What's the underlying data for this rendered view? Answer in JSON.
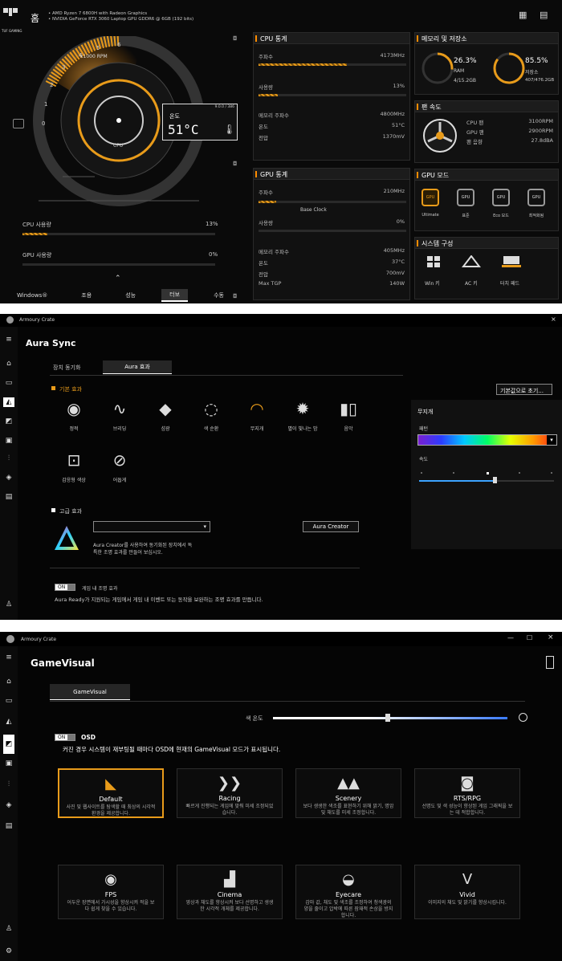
{
  "p1": {
    "logo_text": "TUF GAMING",
    "home": "홈",
    "cpu_name": "AMD Ryzen 7 6800H with Radeon Graphics",
    "gpu_name": "NVIDIA GeForce RTX 3060 Laptop GPU GDDR6 @ 6GB (192 bits)",
    "gauge_unit": "x1000 RPM",
    "gauge_ticks": [
      "1",
      "2",
      "3",
      "4",
      "5",
      "6",
      "0"
    ],
    "gauge_center": "CPU",
    "temp_code": "9.0.0 / 386",
    "temp_label": "온도",
    "temp_value": "51°C",
    "cpu_usage_label": "CPU 사용량",
    "cpu_usage_value": "13%",
    "cpu_usage_fraction": 0.13,
    "gpu_usage_label": "GPU 사용량",
    "gpu_usage_value": "0%",
    "gpu_usage_fraction": 0.0,
    "modes": [
      "Windows®",
      "조용",
      "성능",
      "터보",
      "수동"
    ],
    "active_mode": "터보",
    "cpu_stats": {
      "title": "CPU 통계",
      "freq_label": "주파수",
      "freq_value": "4173MHz",
      "usage_label": "사용량",
      "usage_value": "13%",
      "mem_freq_label": "메모리 주파수",
      "mem_freq_value": "4800MHz",
      "temp_label": "온도",
      "temp_value": "51°C",
      "volt_label": "전압",
      "volt_value": "1370mV"
    },
    "gpu_stats": {
      "title": "GPU 통계",
      "freq_label": "주파수",
      "freq_value": "210MHz",
      "base_clock": "Base Clock",
      "usage_label": "사용량",
      "usage_value": "0%",
      "mem_freq_label": "메모리 주파수",
      "mem_freq_value": "405MHz",
      "temp_label": "온도",
      "temp_value": "37°C",
      "volt_label": "전압",
      "volt_value": "700mV",
      "tgp_label": "Max TGP",
      "tgp_value": "140W"
    },
    "memory": {
      "title": "메모리 및 저장소",
      "ram_pct": "26.3%",
      "ram_label": "RAM",
      "ram_detail": "4/15.2GB",
      "ram_fraction": 0.263,
      "disk_pct": "85.5%",
      "disk_label": "저장소",
      "disk_detail": "407/476.2GB",
      "disk_fraction": 0.855
    },
    "fan": {
      "title": "팬 속도",
      "cpu_label": "CPU 팬",
      "cpu_value": "3100RPM",
      "gpu_label": "GPU 팬",
      "gpu_value": "2900RPM",
      "noise_label": "팬 음향",
      "noise_value": "27.8dBA"
    },
    "gpu_mode": {
      "title": "GPU 모드",
      "items": [
        "Ultimate",
        "표준",
        "Eco 모드",
        "최적화됨"
      ],
      "icon_text": "GPU"
    },
    "system": {
      "title": "시스템 구성",
      "items": [
        "Win 키",
        "AC 키",
        "터치 패드"
      ]
    }
  },
  "p2": {
    "app_title": "Armoury Crate",
    "page_title": "Aura Sync",
    "tabs": [
      "장치 동기화",
      "Aura 효과"
    ],
    "section_basic": "기본 효과",
    "reset_button": "기본값으로 초기...",
    "effects": [
      "정적",
      "브리딩",
      "섬광",
      "색 순환",
      "무지개",
      "별이 빛나는 밤",
      "음악",
      "감응형 색상",
      "어둡게"
    ],
    "active_effect": "무지개",
    "right_title": "무지개",
    "pattern_label": "패턴",
    "speed_label": "속도",
    "speed_fraction": 0.56,
    "section_advanced": "고급 효과",
    "aura_creator_button": "Aura Creator",
    "aura_creator_desc1": "Aura Creator를 사용하여 동기화된 장치에서 독",
    "aura_creator_desc2": "특한 조명 효과를 만들어 보십시오.",
    "ingame_toggle": "ON",
    "ingame_label": "게임 내 조명 효과",
    "ingame_desc": "Aura Ready가 지원되는 게임에서 게임 내 이벤트 또는 동작을 보완하는 조명 효과를 만듭니다."
  },
  "p3": {
    "app_title": "Armoury Crate",
    "page_title": "GameVisual",
    "tab": "GameVisual",
    "color_temp_label": "색 온도",
    "color_temp_fraction": 0.49,
    "osd_toggle": "ON",
    "osd_label": "OSD",
    "osd_desc": "커진 경우 시스템이 재부팅될 때마다 OSD에 현재의 GameVisual 모드가 표시됩니다.",
    "modes": [
      {
        "name": "Default",
        "desc": "사진 및 웹사이트를 탐색할 때 최상의 시각적 환경을 제공합니다."
      },
      {
        "name": "Racing",
        "desc": "빠르게 진행되는 게임에 맞춰 미세 조정되었습니다."
      },
      {
        "name": "Scenery",
        "desc": "보다 생생한 색조를 표현하기 위해 밝기, 명암 및 채도를 미세 조정합니다."
      },
      {
        "name": "RTS/RPG",
        "desc": "선명도 및 색 성능이 향상된 게임 그래픽을 보는 데 적합합니다."
      },
      {
        "name": "FPS",
        "desc": "어두운 장면에서 가시성을 향상시켜 적을 보다 쉽게 찾을 수 있습니다."
      },
      {
        "name": "Cinema",
        "desc": "영상과 채도를 향상시켜 보다 선명하고 생생한 시각적 개체를 제공합니다."
      },
      {
        "name": "Eyecare",
        "desc": "감마 값, 채도 및 색조를 조정하여 청색광의 양을 줄이고 압박에 따른 잠재적 손상을 방지합니다."
      },
      {
        "name": "Vivid",
        "desc": "이미지의 채도 및 밝기를 향상시킵니다."
      }
    ]
  }
}
